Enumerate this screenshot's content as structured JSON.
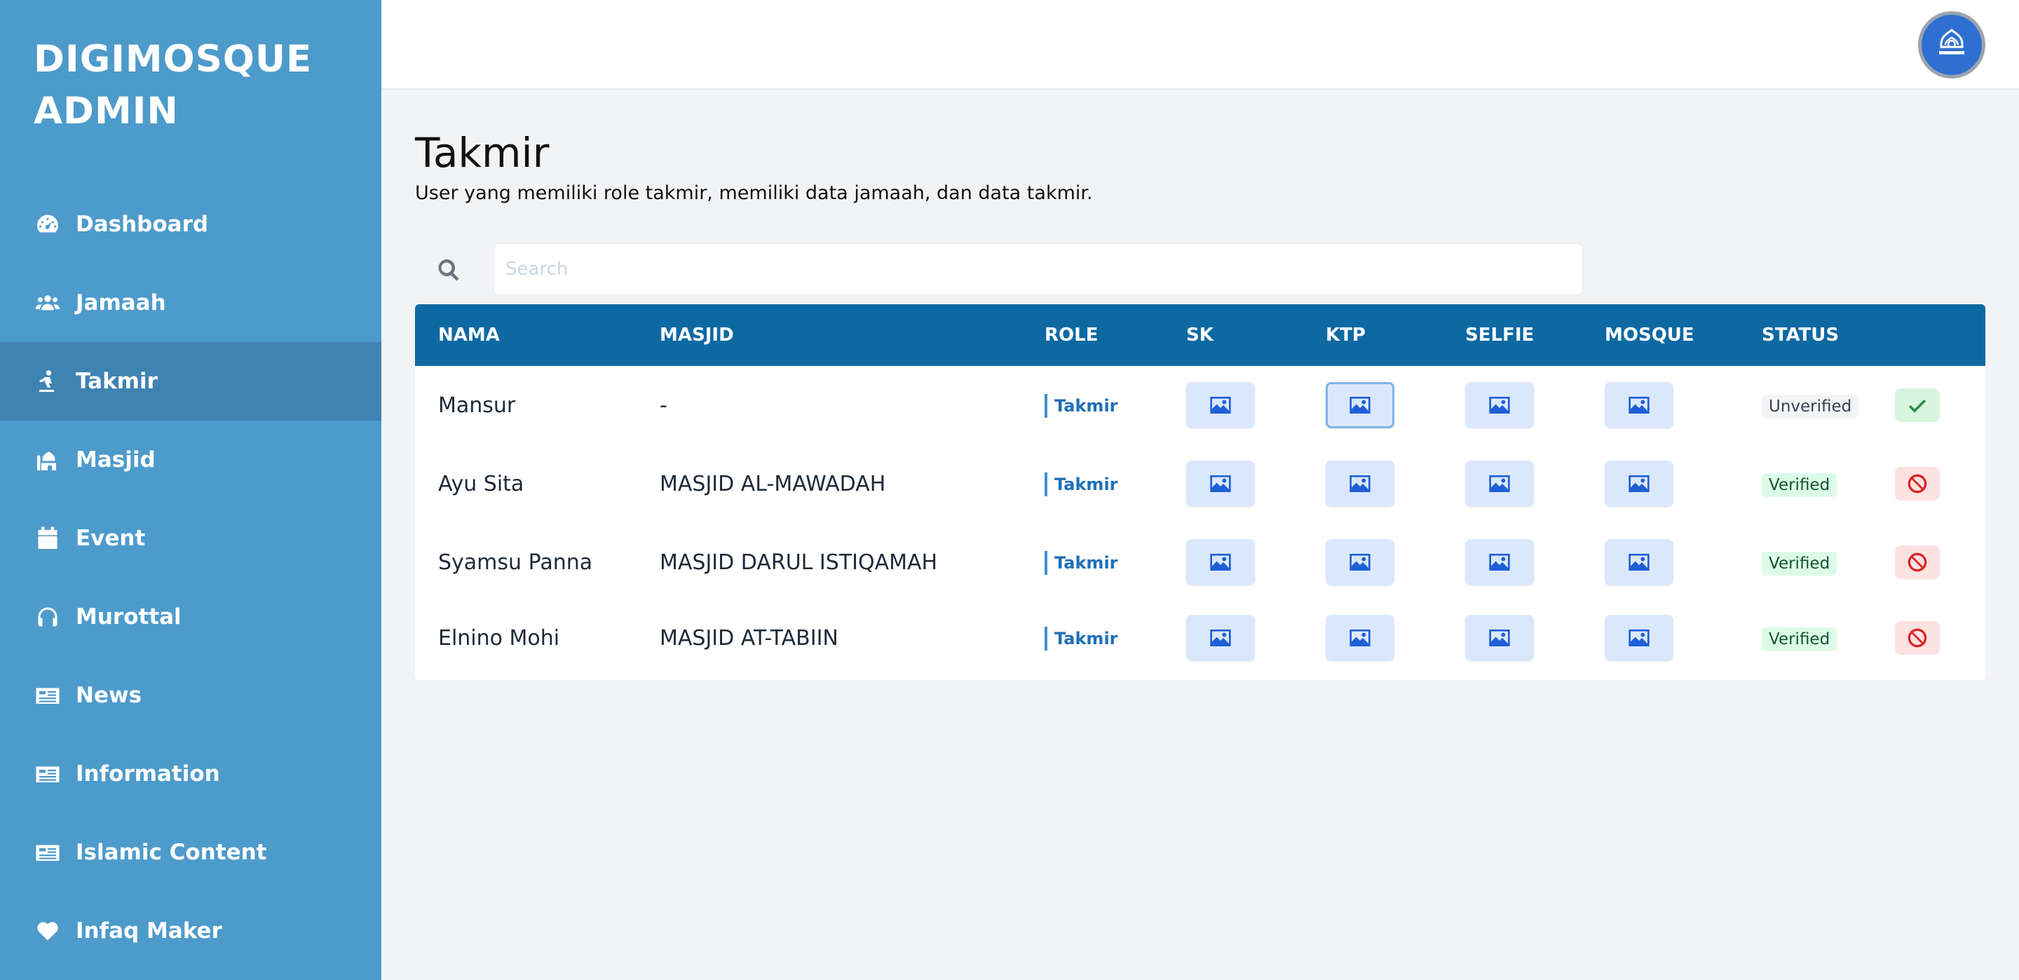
{
  "sidebar": {
    "brand_line1": "DIGIMOSQUE",
    "brand_line2": "ADMIN",
    "items": [
      {
        "label": "Dashboard",
        "icon": "tachometer-icon"
      },
      {
        "label": "Jamaah",
        "icon": "users-icon"
      },
      {
        "label": "Takmir",
        "icon": "praying-icon",
        "active": true
      },
      {
        "label": "Masjid",
        "icon": "mosque-icon"
      },
      {
        "label": "Event",
        "icon": "calendar-icon"
      },
      {
        "label": "Murottal",
        "icon": "headphones-icon"
      },
      {
        "label": "News",
        "icon": "newspaper-icon"
      },
      {
        "label": "Information",
        "icon": "newspaper-icon"
      },
      {
        "label": "Islamic Content",
        "icon": "newspaper-icon"
      },
      {
        "label": "Infaq Maker",
        "icon": "heart-icon"
      }
    ]
  },
  "header": {
    "avatar_icon": "digimosque-logo"
  },
  "page": {
    "title": "Takmir",
    "subtitle": "User yang memiliki role takmir, memiliki data jamaah, dan data takmir."
  },
  "search": {
    "placeholder": "Search",
    "value": ""
  },
  "table": {
    "columns": [
      "NAMA",
      "MASJID",
      "ROLE",
      "SK",
      "KTP",
      "SELFIE",
      "MOSQUE",
      "STATUS"
    ],
    "rows": [
      {
        "nama": "Mansur",
        "masjid": "-",
        "role": "Takmir",
        "status": "Unverified",
        "action": "verify"
      },
      {
        "nama": "Ayu Sita",
        "masjid": "MASJID AL-MAWADAH",
        "role": "Takmir",
        "status": "Verified",
        "action": "unverify"
      },
      {
        "nama": "Syamsu Panna",
        "masjid": "MASJID DARUL ISTIQAMAH",
        "role": "Takmir",
        "status": "Verified",
        "action": "unverify"
      },
      {
        "nama": "Elnino Mohi",
        "masjid": "MASJID AT-TABIIN",
        "role": "Takmir",
        "status": "Verified",
        "action": "unverify"
      }
    ]
  },
  "colors": {
    "sidebar_bg": "#4d9bcb",
    "sidebar_active": "#3f83b2",
    "table_header": "#0e69a3",
    "image_button_bg": "#dbe8fb",
    "verified_bg": "#dcfce7",
    "unverified_bg": "#f3f4f6",
    "danger": "#dc2626",
    "success": "#2f8a4b"
  }
}
